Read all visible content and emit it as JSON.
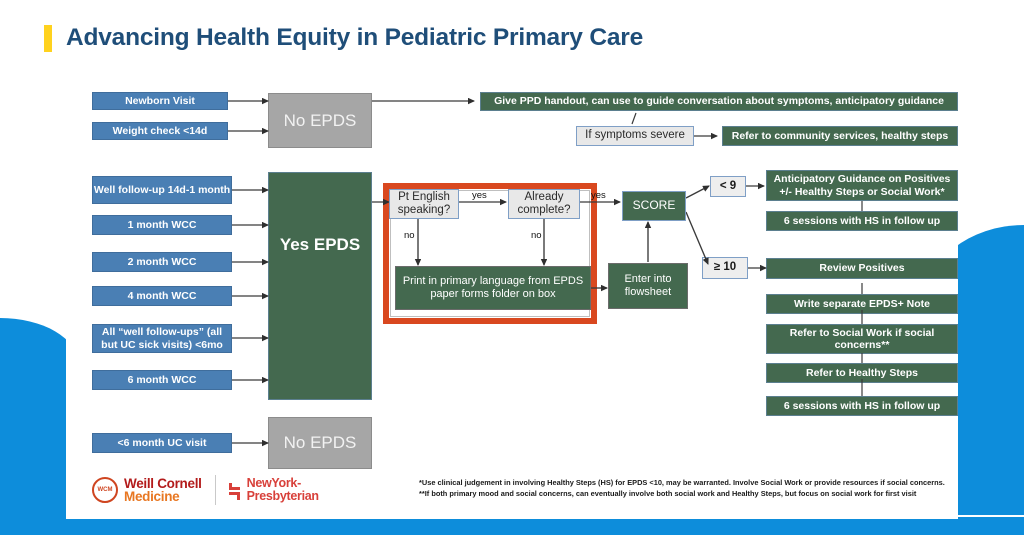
{
  "title": "Advancing Health Equity in Pediatric Primary Care",
  "colors": {
    "title": "#1f4e79",
    "title_accent": "#ffd21e",
    "blue_box": "#4a7fb4",
    "green_box": "#44694f",
    "gray_box": "#a6a6a6",
    "red_highlight": "#d9481f",
    "swoosh_blue": "#0d8ddb",
    "wcm_red": "#b31b1b",
    "wcm_orange": "#e87722",
    "nyp_red": "#d8403a"
  },
  "visit_triggers_no_epds_top": [
    {
      "label": "Newborn Visit"
    },
    {
      "label": "Weight check <14d"
    }
  ],
  "visit_triggers_yes_epds": [
    {
      "label": "Well follow-up 14d-1 month"
    },
    {
      "label": "1 month WCC"
    },
    {
      "label": "2 month WCC"
    },
    {
      "label": "4 month WCC"
    },
    {
      "label": "All “well follow-ups” (all but UC sick visits) <6mo"
    },
    {
      "label": "6 month WCC"
    }
  ],
  "visit_triggers_no_epds_bottom": [
    {
      "label": "<6 month UC visit"
    }
  ],
  "decision_nodes": {
    "no_epds_top": "No EPDS",
    "yes_epds": "Yes EPDS",
    "no_epds_bottom": "No EPDS"
  },
  "no_epds_branch": {
    "handout": "Give PPD handout, can use to guide conversation about symptoms, anticipatory guidance",
    "severe_condition": "If symptoms severe",
    "referral": "Refer to community services, healthy steps"
  },
  "epds_workflow": {
    "q_english": "Pt English speaking?",
    "q_already_complete": "Already complete?",
    "print_forms": "Print in primary language from EPDS paper forms  folder on box",
    "enter_flowsheet": "Enter into flowsheet",
    "score": "SCORE"
  },
  "edge_labels": {
    "yes_1": "yes",
    "no_1": "no",
    "no_2": "no",
    "yes_2": "yes",
    "score_low": "< 9",
    "score_high": "≥ 10"
  },
  "low_score_actions": [
    {
      "label": "Anticipatory Guidance on Positives +/- Healthy Steps or Social Work*"
    },
    {
      "label": "6 sessions with HS in follow up"
    }
  ],
  "high_score_actions": [
    {
      "label": "Review Positives"
    },
    {
      "label": "Write separate EPDS+ Note"
    },
    {
      "label": "Refer to Social Work if social concerns**"
    },
    {
      "label": "Refer to Healthy Steps"
    },
    {
      "label": "6 sessions with HS in follow up"
    }
  ],
  "footnotes": [
    "*Use clinical judgement in involving Healthy Steps (HS) for EPDS <10, may be warranted. Involve Social Work or provide resources if social concerns.",
    "**If both primary mood and social concerns, can eventually involve both social work and Healthy Steps, but focus on social work for first visit"
  ],
  "logos": {
    "wcm_line1": "Weill Cornell",
    "wcm_line2": "Medicine",
    "wcm_seal": "WCM",
    "nyp_line1": "NewYork-",
    "nyp_line2": "Presbyterian"
  }
}
